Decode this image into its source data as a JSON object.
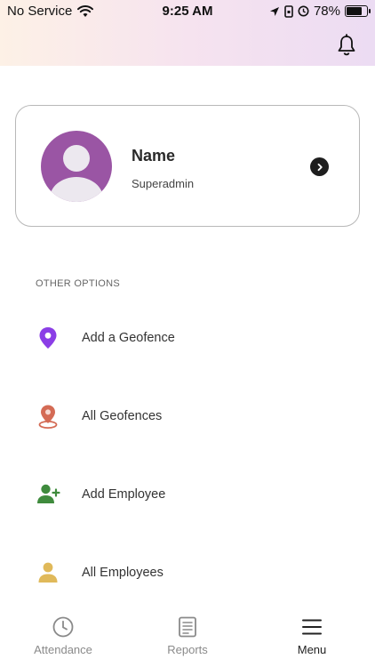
{
  "status_bar": {
    "carrier": "No Service",
    "time": "9:25 AM",
    "battery_percent": "78%",
    "battery_level": 0.78
  },
  "profile": {
    "name": "Name",
    "role": "Superadmin"
  },
  "section_label": "OTHER OPTIONS",
  "menu": {
    "items": [
      {
        "label": "Add a Geofence",
        "icon": "geofence-pin-icon",
        "color": "#8b3ee6"
      },
      {
        "label": "All Geofences",
        "icon": "geofences-location-icon",
        "color": "#d46b55"
      },
      {
        "label": "Add Employee",
        "icon": "add-person-icon",
        "color": "#3f8b3d"
      },
      {
        "label": "All Employees",
        "icon": "person-icon",
        "color": "#e0b95a"
      }
    ]
  },
  "tabs": [
    {
      "label": "Attendance",
      "icon": "clock-icon",
      "active": false
    },
    {
      "label": "Reports",
      "icon": "report-icon",
      "active": false
    },
    {
      "label": "Menu",
      "icon": "menu-icon",
      "active": true
    }
  ],
  "colors": {
    "avatar": "#9a55a4",
    "active_tab": "#222222",
    "inactive_tab": "#8a8a8a"
  }
}
